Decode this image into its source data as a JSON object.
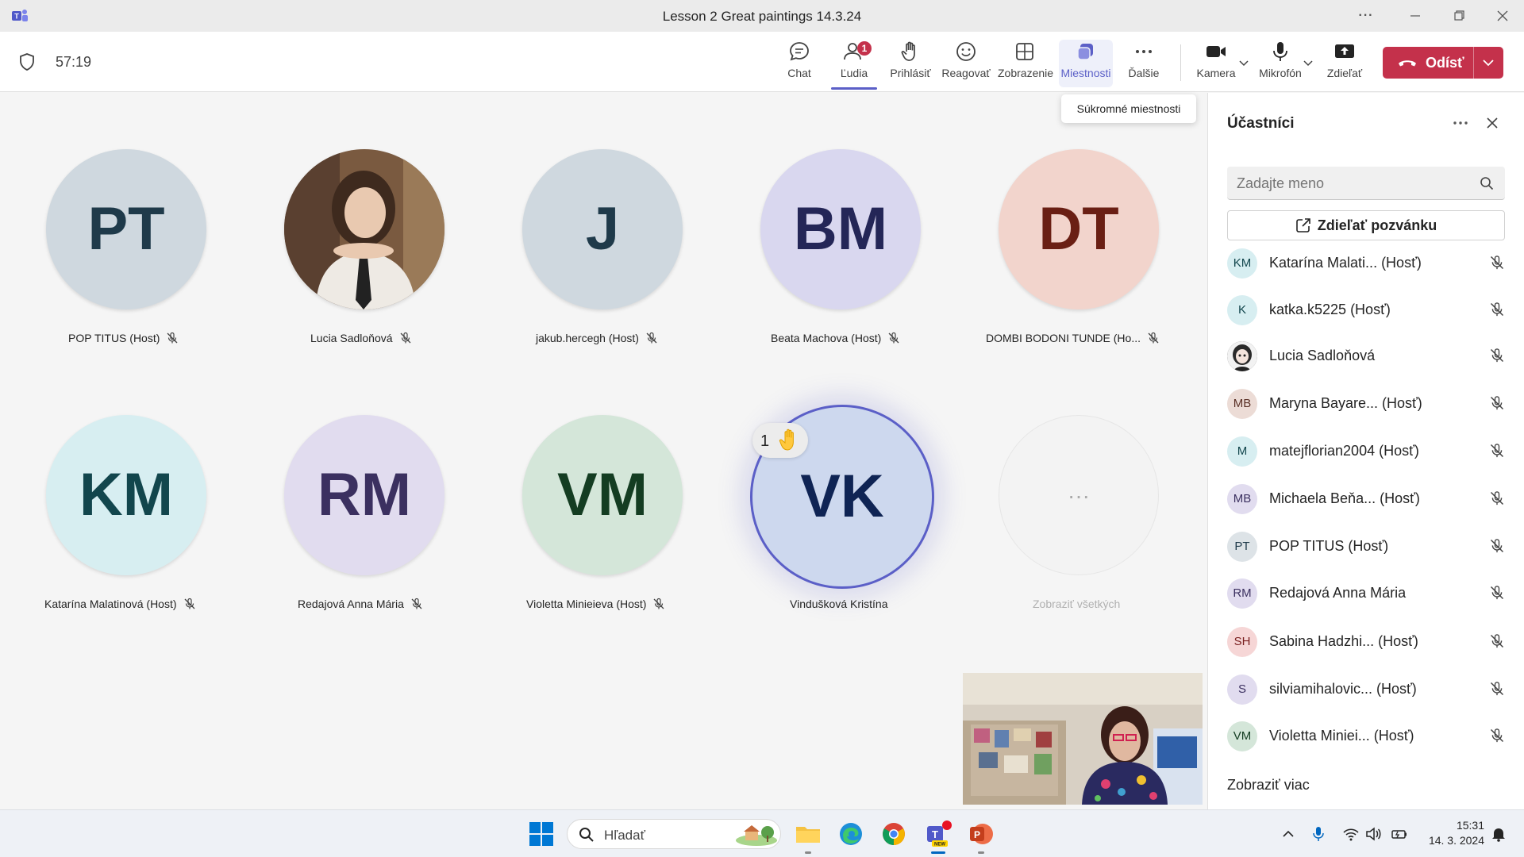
{
  "window": {
    "title": "Lesson 2 Great paintings 14.3.24",
    "more_label": "···"
  },
  "meeting": {
    "timer": "57:19"
  },
  "toolbar": {
    "chat": "Chat",
    "people": "Ľudia",
    "people_badge": "1",
    "raise": "Prihlásiť",
    "react": "Reagovať",
    "view": "Zobrazenie",
    "rooms": "Miestnosti",
    "more": "Ďalšie",
    "camera": "Kamera",
    "mic": "Mikrofón",
    "share": "Zdieľať",
    "leave": "Odísť",
    "rooms_tooltip": "Súkromné miestnosti"
  },
  "tiles": [
    {
      "initials": "PT",
      "name": "POP TITUS (Host)",
      "bg": "#cfd8df",
      "fg": "#1f3a4a"
    },
    {
      "initials": "",
      "name": "Lucia Sadloňová",
      "bg": "#8a6a4e",
      "fg": "#ffffff",
      "photo": true
    },
    {
      "initials": "J",
      "name": "jakub.hercegh (Host)",
      "bg": "#cfd8df",
      "fg": "#1f3a4a"
    },
    {
      "initials": "BM",
      "name": "Beata Machova (Host)",
      "bg": "#d9d7ef",
      "fg": "#242657"
    },
    {
      "initials": "DT",
      "name": "DOMBI BODONI TUNDE (Ho...",
      "bg": "#f2d4cc",
      "fg": "#6a1f14"
    },
    {
      "initials": "KM",
      "name": "Katarína Malatinová (Host)",
      "bg": "#d7eef1",
      "fg": "#12464d"
    },
    {
      "initials": "RM",
      "name": "Redajová Anna Mária",
      "bg": "#e1dcef",
      "fg": "#3b3060"
    },
    {
      "initials": "VM",
      "name": "Violetta Minieieva (Host)",
      "bg": "#d4e6d9",
      "fg": "#143d22"
    },
    {
      "initials": "VK",
      "name": "Vindušková Kristína",
      "bg": "#cdd8ee",
      "fg": "#0f2454",
      "active": true
    },
    {
      "initials": "···",
      "name": "Zobraziť všetkých",
      "more": true
    }
  ],
  "hand": {
    "count": "1"
  },
  "panel": {
    "title": "Účastníci",
    "search_placeholder": "Zadajte meno",
    "share_invite": "Zdieľať pozvánku",
    "show_more": "Zobraziť viac",
    "participants": [
      {
        "initials": "KM",
        "name": "Katarína Malati... (Hosť)",
        "bg": "#d7eef1",
        "fg": "#12464d"
      },
      {
        "initials": "K",
        "name": "katka.k5225 (Hosť)",
        "bg": "#d7eef1",
        "fg": "#12464d"
      },
      {
        "initials": "",
        "name": "Lucia Sadloňová",
        "bg": "#3a3a3a",
        "fg": "#ffffff",
        "photo": true
      },
      {
        "initials": "MB",
        "name": "Maryna Bayare... (Hosť)",
        "bg": "#ecdcd6",
        "fg": "#5a3026"
      },
      {
        "initials": "M",
        "name": "matejflorian2004 (Hosť)",
        "bg": "#d7eef1",
        "fg": "#12464d"
      },
      {
        "initials": "MB",
        "name": "Michaela Beňa... (Hosť)",
        "bg": "#e1dcef",
        "fg": "#3b3060"
      },
      {
        "initials": "PT",
        "name": "POP TITUS (Hosť)",
        "bg": "#dde3e7",
        "fg": "#1f3a4a"
      },
      {
        "initials": "RM",
        "name": "Redajová Anna Mária",
        "bg": "#e1dcef",
        "fg": "#3b3060"
      },
      {
        "initials": "SH",
        "name": "Sabina Hadzhi... (Hosť)",
        "bg": "#f6d6d6",
        "fg": "#7a1f1f"
      },
      {
        "initials": "S",
        "name": "silviamihalovic... (Hosť)",
        "bg": "#e1dcef",
        "fg": "#3b3060"
      },
      {
        "initials": "VM",
        "name": "Violetta Miniei... (Hosť)",
        "bg": "#d4e6d9",
        "fg": "#143d22"
      }
    ]
  },
  "taskbar": {
    "search_text": "Hľadať",
    "time": "15:31",
    "date": "14. 3. 2024"
  },
  "colors": {
    "accent": "#5b5fc7",
    "leave": "#c4314b"
  }
}
